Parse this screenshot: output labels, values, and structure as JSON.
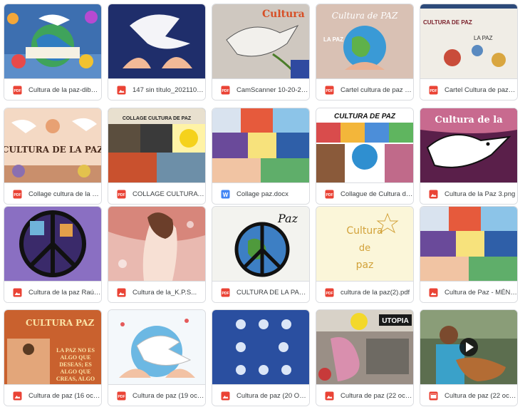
{
  "icons": {
    "pdf": {
      "name": "pdf-icon",
      "color": "#ea4335",
      "label": "PDF"
    },
    "image": {
      "name": "image-icon",
      "color": "#ea4335"
    },
    "word": {
      "name": "word-icon",
      "color": "#4285f4",
      "label": "W"
    },
    "video": {
      "name": "video-icon",
      "color": "#ea4335"
    }
  },
  "files": [
    {
      "name": "Cultura de la paz-dibujo...",
      "type": "pdf"
    },
    {
      "name": "147 sin título_20211019...",
      "type": "image"
    },
    {
      "name": "CamScanner 10-20-2021...",
      "type": "pdf"
    },
    {
      "name": "Cartel cultura de paz Di...",
      "type": "pdf"
    },
    {
      "name": "Cartel Cultura de paz_...",
      "type": "pdf"
    },
    {
      "name": "Collage cultura de la paz...",
      "type": "pdf"
    },
    {
      "name": "COLLAGE CULTURA DE PAZ...",
      "type": "pdf"
    },
    {
      "name": "Collage paz.docx",
      "type": "word"
    },
    {
      "name": "Collague de Cultura de ...",
      "type": "pdf"
    },
    {
      "name": "Cultura de la Paz 3.png",
      "type": "image"
    },
    {
      "name": "Cultura de la paz Raúl ...",
      "type": "image"
    },
    {
      "name": "Cultura de la_K.P.S...",
      "type": "image"
    },
    {
      "name": "CULTURA DE LA PAZ(1...",
      "type": "pdf"
    },
    {
      "name": "cultura de la paz(2).pdf",
      "type": "pdf"
    },
    {
      "name": "Cultura de Paz - MÉND...",
      "type": "image"
    },
    {
      "name": "Cultura de paz (16 oct ...",
      "type": "image"
    },
    {
      "name": "Cultura de paz (19 oct ...",
      "type": "pdf"
    },
    {
      "name": "Cultura de paz (20 Oct ...",
      "type": "image"
    },
    {
      "name": "Cultura de paz (22 oct ...",
      "type": "image"
    },
    {
      "name": "Cultura de paz (22 oct ...",
      "type": "video"
    }
  ],
  "thumb_text": {
    "t3": "Cultura",
    "t4a": "Cultura de PAZ",
    "t4b": "LA PAZ",
    "t5a": "CULTURA DE PAZ",
    "t5b": "LA PAZ",
    "t6": "CULTURA DE LA PAZ",
    "t7a": "COLLAGE CULTURA DE PAZ",
    "t9": "CULTURA DE PAZ",
    "t10": "Cultura de la",
    "t13": "Paz",
    "t14a": "Cultura",
    "t14b": "de",
    "t14c": "paz",
    "t16a": "CULTURA",
    "t16b": "PAZ",
    "t16c": "LA PAZ NO ES ALGO QUE DESEAS; ES ALGO QUE CREAS, ALGO",
    "t19": "UTOPIA"
  },
  "colors": {
    "border": "#dadce0",
    "text": "#3c4043",
    "accent_red": "#ea4335",
    "accent_blue": "#4285f4"
  }
}
